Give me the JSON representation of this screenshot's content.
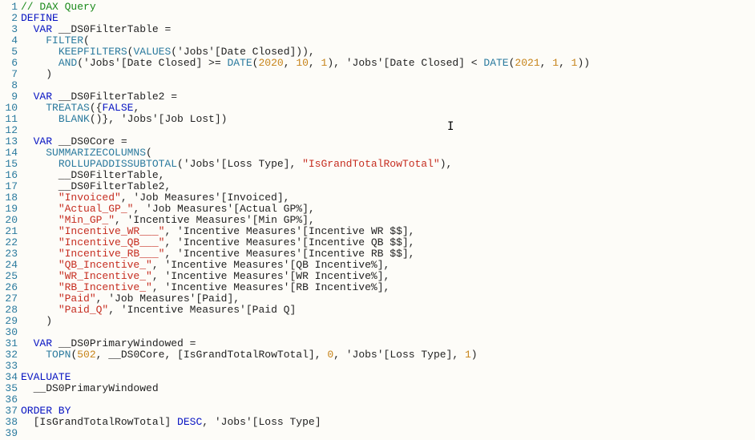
{
  "lines": [
    {
      "n": 1,
      "segs": [
        {
          "c": "c-comment",
          "t": "// DAX Query"
        }
      ]
    },
    {
      "n": 2,
      "segs": [
        {
          "c": "c-blue",
          "t": "DEFINE"
        }
      ]
    },
    {
      "n": 3,
      "segs": [
        {
          "c": "c-default",
          "t": "  "
        },
        {
          "c": "c-blue",
          "t": "VAR"
        },
        {
          "c": "c-default",
          "t": " __DS0FilterTable ="
        }
      ]
    },
    {
      "n": 4,
      "segs": [
        {
          "c": "c-default",
          "t": "    "
        },
        {
          "c": "c-func",
          "t": "FILTER"
        },
        {
          "c": "c-default",
          "t": "("
        }
      ]
    },
    {
      "n": 5,
      "segs": [
        {
          "c": "c-default",
          "t": "      "
        },
        {
          "c": "c-func",
          "t": "KEEPFILTERS"
        },
        {
          "c": "c-default",
          "t": "("
        },
        {
          "c": "c-func",
          "t": "VALUES"
        },
        {
          "c": "c-default",
          "t": "('Jobs'[Date Closed])),"
        }
      ]
    },
    {
      "n": 6,
      "segs": [
        {
          "c": "c-default",
          "t": "      "
        },
        {
          "c": "c-func",
          "t": "AND"
        },
        {
          "c": "c-default",
          "t": "('Jobs'[Date Closed] >= "
        },
        {
          "c": "c-func",
          "t": "DATE"
        },
        {
          "c": "c-default",
          "t": "("
        },
        {
          "c": "c-num",
          "t": "2020"
        },
        {
          "c": "c-default",
          "t": ", "
        },
        {
          "c": "c-num",
          "t": "10"
        },
        {
          "c": "c-default",
          "t": ", "
        },
        {
          "c": "c-num",
          "t": "1"
        },
        {
          "c": "c-default",
          "t": "), 'Jobs'[Date Closed] < "
        },
        {
          "c": "c-func",
          "t": "DATE"
        },
        {
          "c": "c-default",
          "t": "("
        },
        {
          "c": "c-num",
          "t": "2021"
        },
        {
          "c": "c-default",
          "t": ", "
        },
        {
          "c": "c-num",
          "t": "1"
        },
        {
          "c": "c-default",
          "t": ", "
        },
        {
          "c": "c-num",
          "t": "1"
        },
        {
          "c": "c-default",
          "t": "))"
        }
      ]
    },
    {
      "n": 7,
      "segs": [
        {
          "c": "c-default",
          "t": "    )"
        }
      ]
    },
    {
      "n": 8,
      "segs": [
        {
          "c": "c-default",
          "t": ""
        }
      ]
    },
    {
      "n": 9,
      "segs": [
        {
          "c": "c-default",
          "t": "  "
        },
        {
          "c": "c-blue",
          "t": "VAR"
        },
        {
          "c": "c-default",
          "t": " __DS0FilterTable2 ="
        }
      ]
    },
    {
      "n": 10,
      "segs": [
        {
          "c": "c-default",
          "t": "    "
        },
        {
          "c": "c-func",
          "t": "TREATAS"
        },
        {
          "c": "c-default",
          "t": "({"
        },
        {
          "c": "c-blue",
          "t": "FALSE"
        },
        {
          "c": "c-default",
          "t": ","
        }
      ]
    },
    {
      "n": 11,
      "segs": [
        {
          "c": "c-default",
          "t": "      "
        },
        {
          "c": "c-func",
          "t": "BLANK"
        },
        {
          "c": "c-default",
          "t": "()}, 'Jobs'[Job Lost])"
        }
      ]
    },
    {
      "n": 12,
      "segs": [
        {
          "c": "c-default",
          "t": ""
        }
      ]
    },
    {
      "n": 13,
      "segs": [
        {
          "c": "c-default",
          "t": "  "
        },
        {
          "c": "c-blue",
          "t": "VAR"
        },
        {
          "c": "c-default",
          "t": " __DS0Core ="
        }
      ]
    },
    {
      "n": 14,
      "segs": [
        {
          "c": "c-default",
          "t": "    "
        },
        {
          "c": "c-func",
          "t": "SUMMARIZECOLUMNS"
        },
        {
          "c": "c-default",
          "t": "("
        }
      ]
    },
    {
      "n": 15,
      "segs": [
        {
          "c": "c-default",
          "t": "      "
        },
        {
          "c": "c-func",
          "t": "ROLLUPADDISSUBTOTAL"
        },
        {
          "c": "c-default",
          "t": "('Jobs'[Loss Type], "
        },
        {
          "c": "c-str",
          "t": "\"IsGrandTotalRowTotal\""
        },
        {
          "c": "c-default",
          "t": "),"
        }
      ]
    },
    {
      "n": 16,
      "segs": [
        {
          "c": "c-default",
          "t": "      __DS0FilterTable,"
        }
      ]
    },
    {
      "n": 17,
      "segs": [
        {
          "c": "c-default",
          "t": "      __DS0FilterTable2,"
        }
      ]
    },
    {
      "n": 18,
      "segs": [
        {
          "c": "c-default",
          "t": "      "
        },
        {
          "c": "c-str",
          "t": "\"Invoiced\""
        },
        {
          "c": "c-default",
          "t": ", 'Job Measures'[Invoiced],"
        }
      ]
    },
    {
      "n": 19,
      "segs": [
        {
          "c": "c-default",
          "t": "      "
        },
        {
          "c": "c-str",
          "t": "\"Actual_GP_\""
        },
        {
          "c": "c-default",
          "t": ", 'Job Measures'[Actual GP%],"
        }
      ]
    },
    {
      "n": 20,
      "segs": [
        {
          "c": "c-default",
          "t": "      "
        },
        {
          "c": "c-str",
          "t": "\"Min_GP_\""
        },
        {
          "c": "c-default",
          "t": ", 'Incentive Measures'[Min GP%],"
        }
      ]
    },
    {
      "n": 21,
      "segs": [
        {
          "c": "c-default",
          "t": "      "
        },
        {
          "c": "c-str",
          "t": "\"Incentive_WR___\""
        },
        {
          "c": "c-default",
          "t": ", 'Incentive Measures'[Incentive WR $$],"
        }
      ]
    },
    {
      "n": 22,
      "segs": [
        {
          "c": "c-default",
          "t": "      "
        },
        {
          "c": "c-str",
          "t": "\"Incentive_QB___\""
        },
        {
          "c": "c-default",
          "t": ", 'Incentive Measures'[Incentive QB $$],"
        }
      ]
    },
    {
      "n": 23,
      "segs": [
        {
          "c": "c-default",
          "t": "      "
        },
        {
          "c": "c-str",
          "t": "\"Incentive_RB___\""
        },
        {
          "c": "c-default",
          "t": ", 'Incentive Measures'[Incentive RB $$],"
        }
      ]
    },
    {
      "n": 24,
      "segs": [
        {
          "c": "c-default",
          "t": "      "
        },
        {
          "c": "c-str",
          "t": "\"QB_Incentive_\""
        },
        {
          "c": "c-default",
          "t": ", 'Incentive Measures'[QB Incentive%],"
        }
      ]
    },
    {
      "n": 25,
      "segs": [
        {
          "c": "c-default",
          "t": "      "
        },
        {
          "c": "c-str",
          "t": "\"WR_Incentive_\""
        },
        {
          "c": "c-default",
          "t": ", 'Incentive Measures'[WR Incentive%],"
        }
      ]
    },
    {
      "n": 26,
      "segs": [
        {
          "c": "c-default",
          "t": "      "
        },
        {
          "c": "c-str",
          "t": "\"RB_Incentive_\""
        },
        {
          "c": "c-default",
          "t": ", 'Incentive Measures'[RB Incentive%],"
        }
      ]
    },
    {
      "n": 27,
      "segs": [
        {
          "c": "c-default",
          "t": "      "
        },
        {
          "c": "c-str",
          "t": "\"Paid\""
        },
        {
          "c": "c-default",
          "t": ", 'Job Measures'[Paid],"
        }
      ]
    },
    {
      "n": 28,
      "segs": [
        {
          "c": "c-default",
          "t": "      "
        },
        {
          "c": "c-str",
          "t": "\"Paid_Q\""
        },
        {
          "c": "c-default",
          "t": ", 'Incentive Measures'[Paid Q]"
        }
      ]
    },
    {
      "n": 29,
      "segs": [
        {
          "c": "c-default",
          "t": "    )"
        }
      ]
    },
    {
      "n": 30,
      "segs": [
        {
          "c": "c-default",
          "t": ""
        }
      ]
    },
    {
      "n": 31,
      "segs": [
        {
          "c": "c-default",
          "t": "  "
        },
        {
          "c": "c-blue",
          "t": "VAR"
        },
        {
          "c": "c-default",
          "t": " __DS0PrimaryWindowed ="
        }
      ]
    },
    {
      "n": 32,
      "segs": [
        {
          "c": "c-default",
          "t": "    "
        },
        {
          "c": "c-func",
          "t": "TOPN"
        },
        {
          "c": "c-default",
          "t": "("
        },
        {
          "c": "c-num",
          "t": "502"
        },
        {
          "c": "c-default",
          "t": ", __DS0Core, [IsGrandTotalRowTotal], "
        },
        {
          "c": "c-num",
          "t": "0"
        },
        {
          "c": "c-default",
          "t": ", 'Jobs'[Loss Type], "
        },
        {
          "c": "c-num",
          "t": "1"
        },
        {
          "c": "c-default",
          "t": ")"
        }
      ]
    },
    {
      "n": 33,
      "segs": [
        {
          "c": "c-default",
          "t": ""
        }
      ]
    },
    {
      "n": 34,
      "segs": [
        {
          "c": "c-blue",
          "t": "EVALUATE"
        }
      ]
    },
    {
      "n": 35,
      "segs": [
        {
          "c": "c-default",
          "t": "  __DS0PrimaryWindowed"
        }
      ]
    },
    {
      "n": 36,
      "segs": [
        {
          "c": "c-default",
          "t": ""
        }
      ]
    },
    {
      "n": 37,
      "segs": [
        {
          "c": "c-blue",
          "t": "ORDER BY"
        }
      ]
    },
    {
      "n": 38,
      "segs": [
        {
          "c": "c-default",
          "t": "  [IsGrandTotalRowTotal] "
        },
        {
          "c": "c-blue",
          "t": "DESC"
        },
        {
          "c": "c-default",
          "t": ", 'Jobs'[Loss Type]"
        }
      ]
    },
    {
      "n": 39,
      "segs": [
        {
          "c": "c-default",
          "t": ""
        }
      ]
    }
  ],
  "cursor_glyph": "I"
}
